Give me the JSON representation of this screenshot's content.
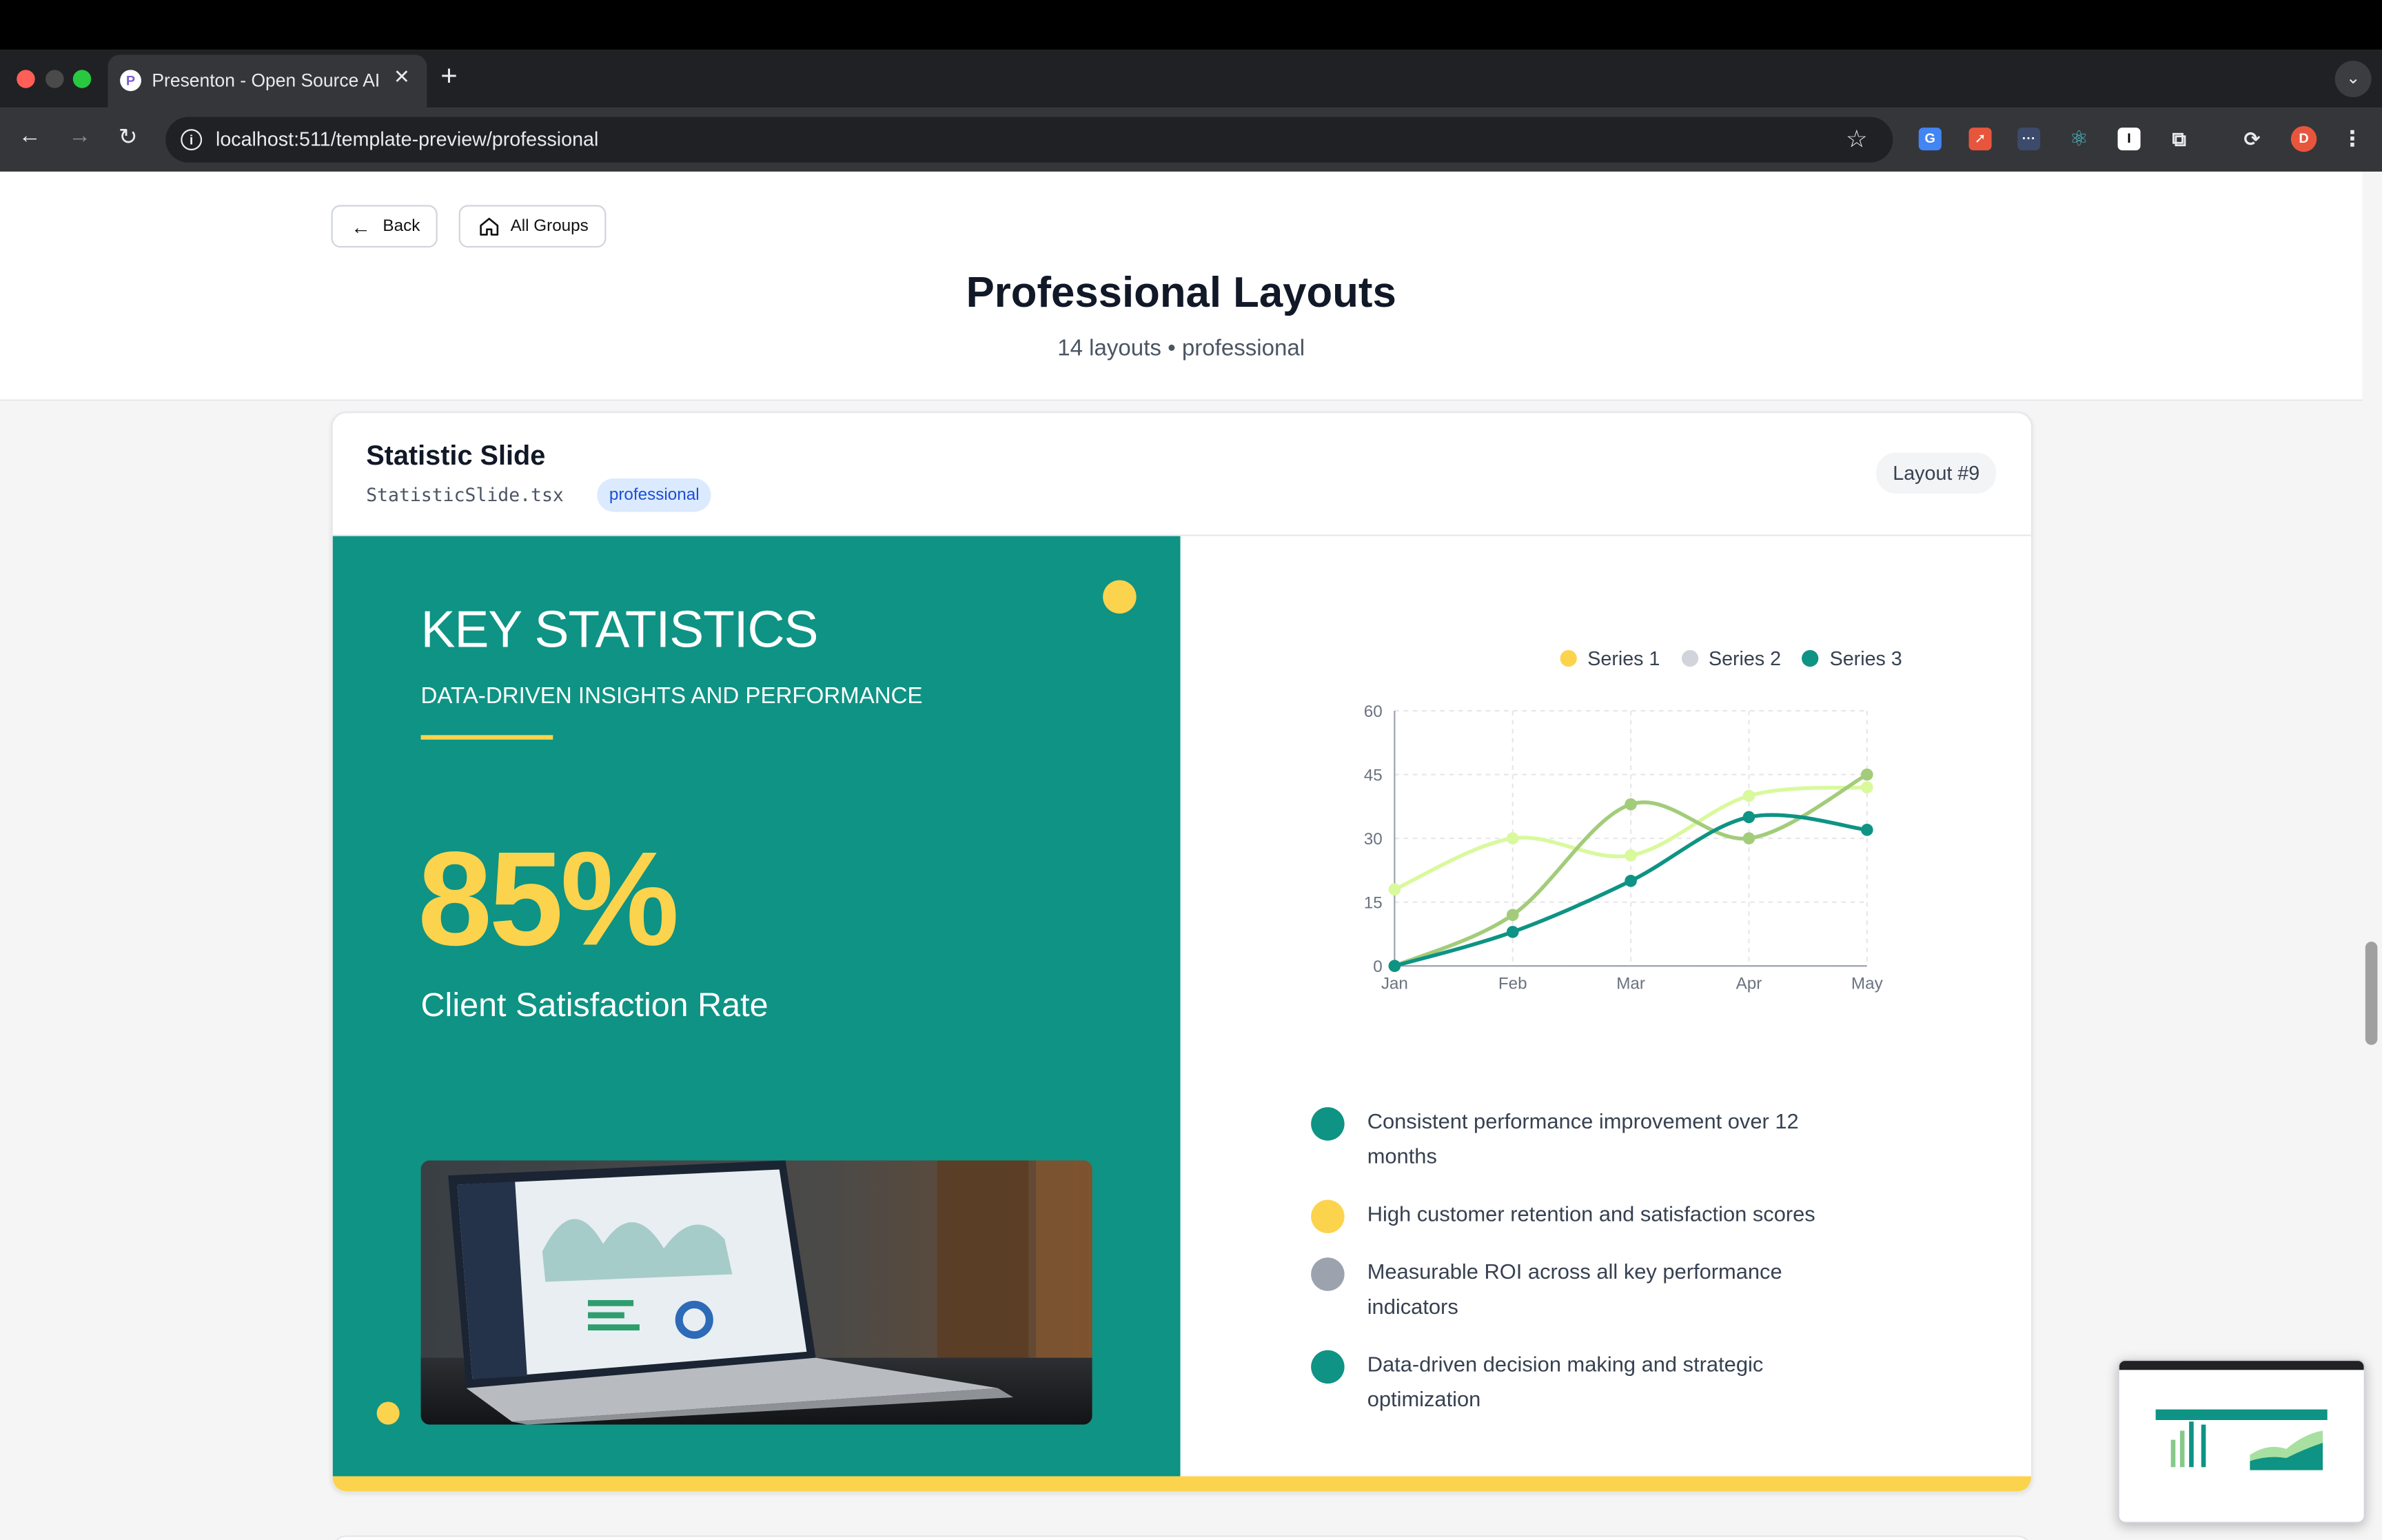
{
  "browser": {
    "tab_title": "Presenton - Open Source AI p",
    "favicon_letter": "P",
    "url": "localhost:511/template-preview/professional",
    "profile_initial": "D"
  },
  "header": {
    "back_label": "Back",
    "all_groups_label": "All Groups",
    "title": "Professional Layouts",
    "subtitle": "14 layouts • professional"
  },
  "card": {
    "title": "Statistic Slide",
    "filename": "StatisticSlide.tsx",
    "tag": "professional",
    "layout_badge": "Layout #9"
  },
  "slide": {
    "title": "KEY STATISTICS",
    "subtitle": "DATA-DRIVEN INSIGHTS AND PERFORMANCE",
    "stat_value": "85%",
    "stat_label": "Client Satisfaction Rate",
    "bullets": [
      {
        "text": "Consistent performance improvement over 12 months",
        "color": "#0e9384"
      },
      {
        "text": "High customer retention and satisfaction scores",
        "color": "#fcd34d"
      },
      {
        "text": "Measurable ROI across all key performance indicators",
        "color": "#9ca3af"
      },
      {
        "text": "Data-driven decision making and strategic optimization",
        "color": "#0e9384"
      }
    ],
    "colors": {
      "teal": "#0e9384",
      "yellow": "#fcd34d",
      "gray": "#d1d5db"
    }
  },
  "chart_data": {
    "type": "line",
    "categories": [
      "Jan",
      "Feb",
      "Mar",
      "Apr",
      "May"
    ],
    "yticks": [
      0,
      15,
      30,
      45,
      60
    ],
    "ylim": [
      0,
      60
    ],
    "grid": true,
    "legend": "top-right",
    "series": [
      {
        "name": "Series 1",
        "color": "#d9f99d",
        "values": [
          18,
          30,
          26,
          40,
          42
        ]
      },
      {
        "name": "Series 2",
        "color": "#a3cc7a",
        "values": [
          0,
          12,
          38,
          30,
          45
        ]
      },
      {
        "name": "Series 3",
        "color": "#0e9384",
        "values": [
          0,
          8,
          20,
          35,
          32
        ]
      }
    ],
    "legend_colors": [
      "#fcd34d",
      "#d1d5db",
      "#0e9384"
    ]
  }
}
